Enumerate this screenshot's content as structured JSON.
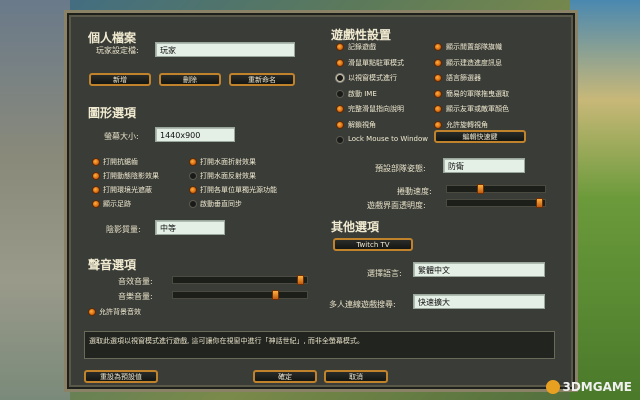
{
  "profile": {
    "title": "個人檔案",
    "player_label": "玩家設定檔:",
    "player_value": "玩家",
    "new_btn": "新增",
    "delete_btn": "刪除",
    "rename_btn": "重新命名"
  },
  "graphics": {
    "title": "圖形選項",
    "screen_size_label": "螢幕大小:",
    "screen_size_value": "1440x900",
    "options": [
      {
        "label": "打開抗鋸齒",
        "checked": true
      },
      {
        "label": "打開水面折射效果",
        "checked": true
      },
      {
        "label": "打開動態陰影效果",
        "checked": true
      },
      {
        "label": "打開水面反射效果",
        "checked": false
      },
      {
        "label": "打開環境光遮蔽",
        "checked": true
      },
      {
        "label": "打開各單位單獨光源功能",
        "checked": true
      },
      {
        "label": "顯示足跡",
        "checked": true
      },
      {
        "label": "啟動垂直同步",
        "checked": false
      }
    ],
    "shadow_label": "陰影質量:",
    "shadow_value": "中等"
  },
  "sound": {
    "title": "聲音選項",
    "sfx_label": "音效音量:",
    "sfx_level": 0.98,
    "music_label": "音樂音量:",
    "music_level": 0.78,
    "bg_audio_label": "允許背景音效",
    "bg_audio_checked": true
  },
  "gameplay": {
    "title": "遊戲性設置",
    "left_options": [
      {
        "label": "記錄遊戲",
        "state": "on"
      },
      {
        "label": "滑鼠單點駐軍模式",
        "state": "on"
      },
      {
        "label": "以視窗模式進行",
        "state": "sel"
      },
      {
        "label": "啟動 IME",
        "state": "off"
      },
      {
        "label": "完整滑鼠指向說明",
        "state": "on"
      },
      {
        "label": "解鎖視角",
        "state": "on"
      },
      {
        "label": "Lock Mouse to Window",
        "state": "off"
      }
    ],
    "right_options": [
      {
        "label": "顯示閒置部隊旗幟",
        "state": "on"
      },
      {
        "label": "顯示建造進度訊息",
        "state": "on"
      },
      {
        "label": "語言篩選器",
        "state": "on"
      },
      {
        "label": "簡易的軍隊拖曳選取",
        "state": "on"
      },
      {
        "label": "顯示友軍或敵軍顏色",
        "state": "on"
      },
      {
        "label": "允許旋轉視角",
        "state": "on"
      }
    ],
    "hotkey_btn": "編輯快速鍵",
    "stance_label": "預設部隊姿態:",
    "stance_value": "防衛",
    "scroll_label": "捲動速度:",
    "scroll_level": 0.33,
    "ui_alpha_label": "遊戲界面透明度:",
    "ui_alpha_level": 0.98
  },
  "other": {
    "title": "其他選項",
    "twitch_btn": "Twitch TV",
    "language_label": "選擇語言:",
    "language_value": "繁體中文",
    "mp_label": "多人連線遊戲搜尋:",
    "mp_value": "快速擴大"
  },
  "description": "選取此選項以視窗模式進行遊戲, 這可讓你在視窗中進行「神話世紀」, 而非全螢幕模式。",
  "footer": {
    "reset_btn": "重設為預設值",
    "ok_btn": "確定",
    "cancel_btn": "取消"
  },
  "watermark": "3DMGAME"
}
